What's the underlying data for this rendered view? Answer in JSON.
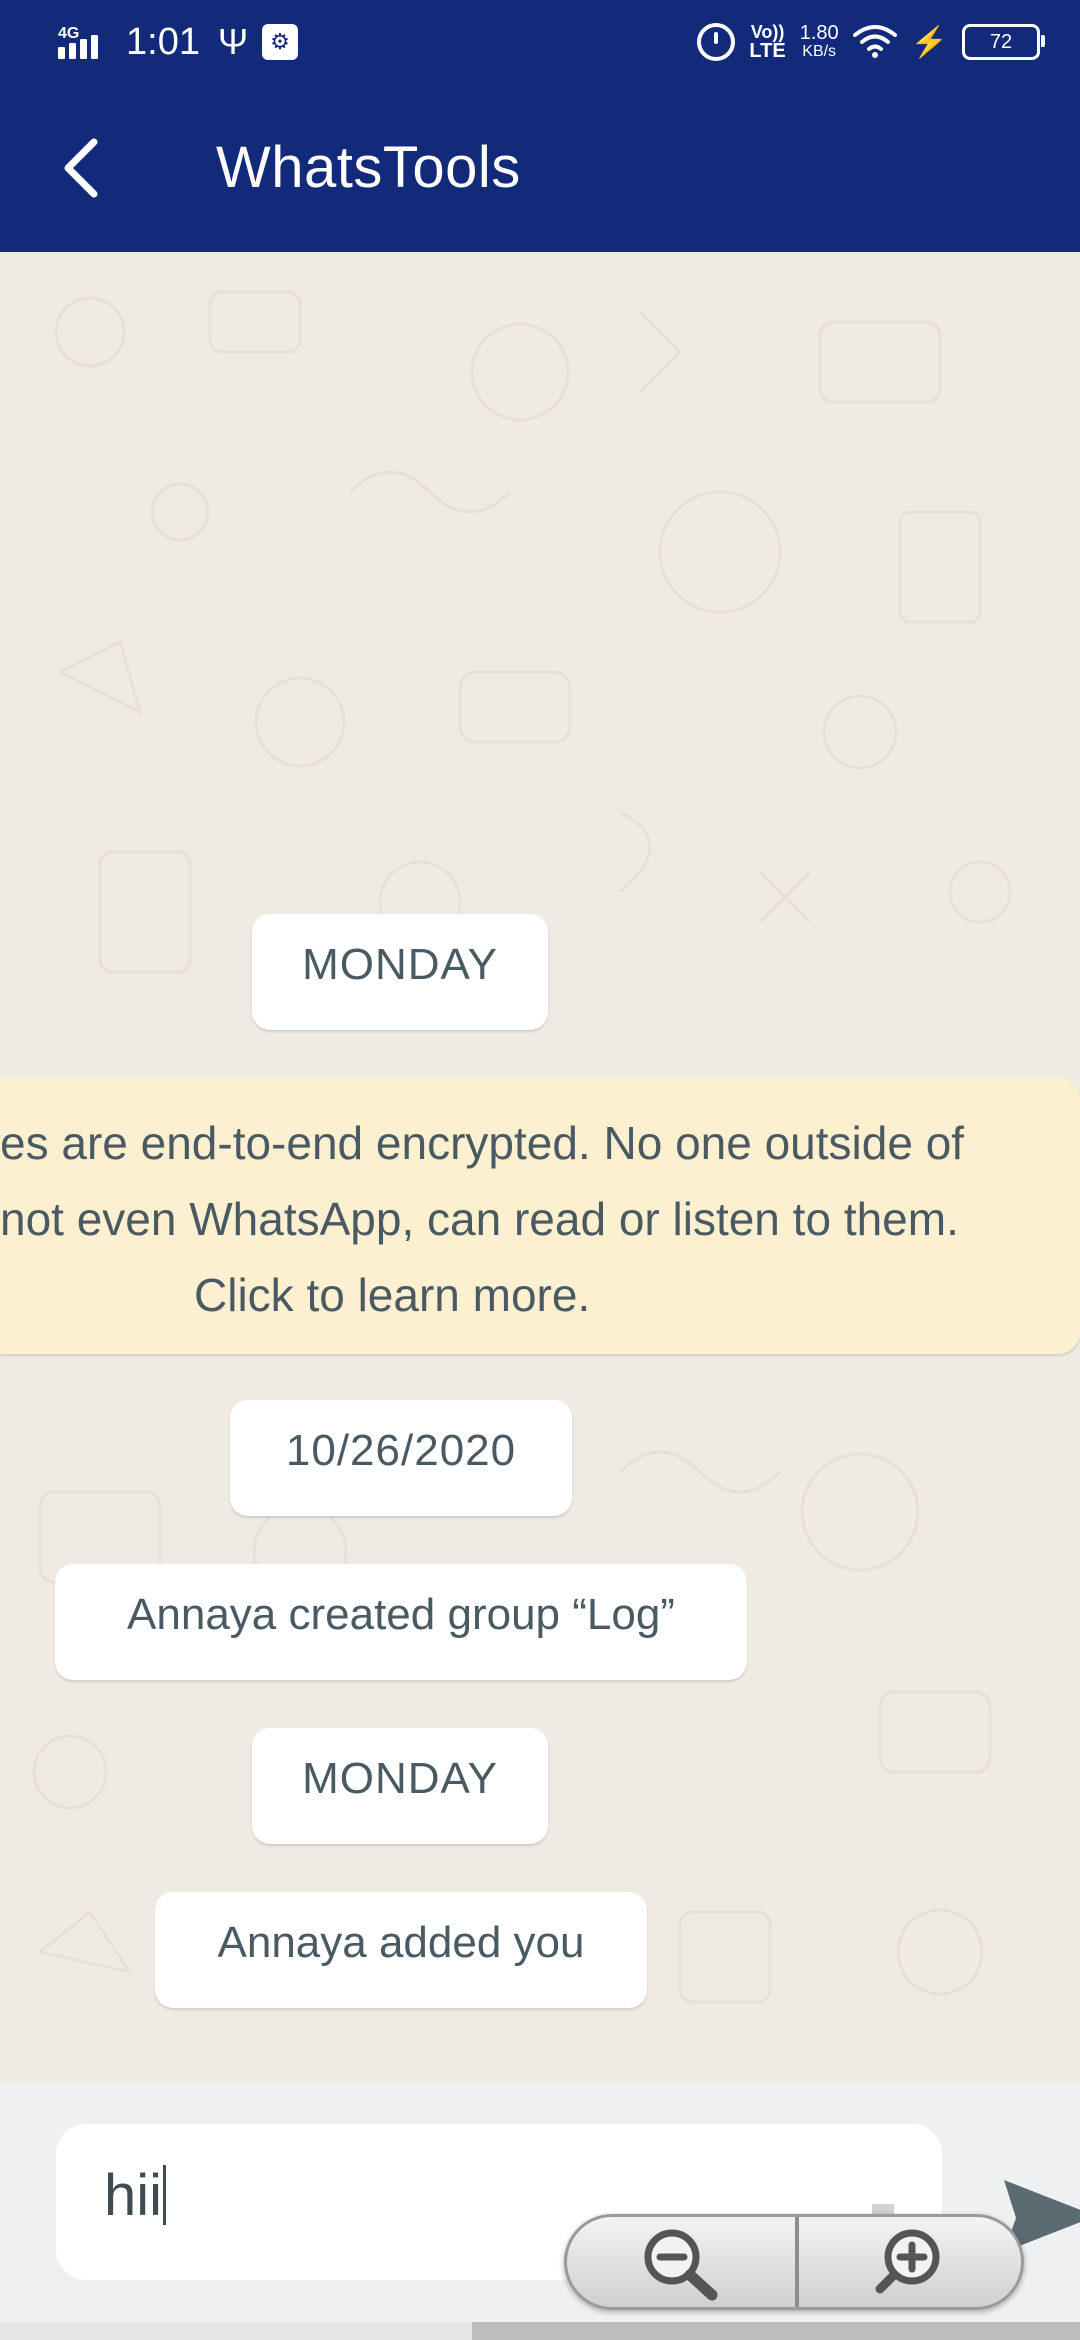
{
  "status_bar": {
    "network_type": "4G",
    "time": "1:01",
    "volte_top": "Vo))",
    "volte_bottom": "LTE",
    "speed_value": "1.80",
    "speed_unit": "KB/s",
    "battery": "72",
    "icons": [
      "signal-icon",
      "usb-icon",
      "usb-settings-icon",
      "alarm-icon",
      "wifi-icon",
      "charging-icon",
      "battery-icon"
    ]
  },
  "toolbar": {
    "title": "WhatsTools",
    "back_icon": "chevron-left-icon"
  },
  "chat": {
    "messages": {
      "date_1": "MONDAY",
      "encryption_line_1": "es are end-to-end encrypted. No one outside of",
      "encryption_line_2": "not even WhatsApp, can read or listen to them.",
      "encryption_line_3": "Click to learn more.",
      "date_2": "10/26/2020",
      "event_1": "Annaya created group “Log”",
      "date_3": "MONDAY",
      "event_2": "Annaya added you"
    }
  },
  "composer": {
    "input_value": "hii",
    "send_icon": "send-icon",
    "zoom_out_icon": "zoom-out-icon",
    "zoom_in_icon": "zoom-in-icon"
  },
  "colors": {
    "header": "#13297a",
    "chat_background": "#efeae2",
    "encryption_banner": "#fdf0d1",
    "pill_text": "#4a5a63",
    "send_button": "#5b6b72"
  }
}
